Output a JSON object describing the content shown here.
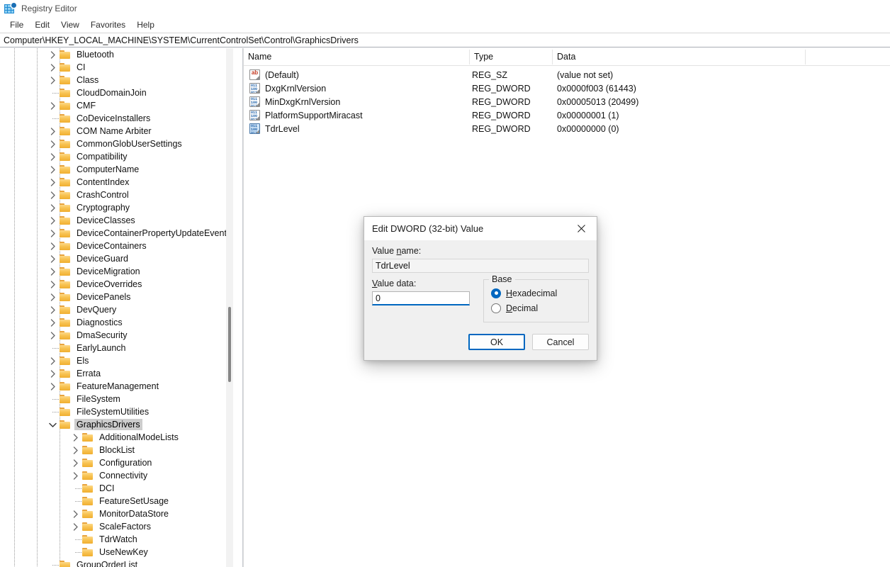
{
  "window": {
    "title": "Registry Editor",
    "icon": "registry-editor-icon"
  },
  "menubar": {
    "items": [
      "File",
      "Edit",
      "View",
      "Favorites",
      "Help"
    ]
  },
  "address": {
    "path": "Computer\\HKEY_LOCAL_MACHINE\\SYSTEM\\CurrentControlSet\\Control\\GraphicsDrivers"
  },
  "tree": {
    "items": [
      {
        "label": "Bluetooth",
        "depth": 1,
        "state": "collapsed",
        "selected": false
      },
      {
        "label": "CI",
        "depth": 1,
        "state": "collapsed",
        "selected": false
      },
      {
        "label": "Class",
        "depth": 1,
        "state": "collapsed",
        "selected": false
      },
      {
        "label": "CloudDomainJoin",
        "depth": 1,
        "state": "leaf",
        "selected": false
      },
      {
        "label": "CMF",
        "depth": 1,
        "state": "collapsed",
        "selected": false
      },
      {
        "label": "CoDeviceInstallers",
        "depth": 1,
        "state": "leaf",
        "selected": false
      },
      {
        "label": "COM Name Arbiter",
        "depth": 1,
        "state": "collapsed",
        "selected": false
      },
      {
        "label": "CommonGlobUserSettings",
        "depth": 1,
        "state": "collapsed",
        "selected": false
      },
      {
        "label": "Compatibility",
        "depth": 1,
        "state": "collapsed",
        "selected": false
      },
      {
        "label": "ComputerName",
        "depth": 1,
        "state": "collapsed",
        "selected": false
      },
      {
        "label": "ContentIndex",
        "depth": 1,
        "state": "collapsed",
        "selected": false
      },
      {
        "label": "CrashControl",
        "depth": 1,
        "state": "collapsed",
        "selected": false
      },
      {
        "label": "Cryptography",
        "depth": 1,
        "state": "collapsed",
        "selected": false
      },
      {
        "label": "DeviceClasses",
        "depth": 1,
        "state": "collapsed",
        "selected": false
      },
      {
        "label": "DeviceContainerPropertyUpdateEvents",
        "depth": 1,
        "state": "collapsed",
        "selected": false
      },
      {
        "label": "DeviceContainers",
        "depth": 1,
        "state": "collapsed",
        "selected": false
      },
      {
        "label": "DeviceGuard",
        "depth": 1,
        "state": "collapsed",
        "selected": false
      },
      {
        "label": "DeviceMigration",
        "depth": 1,
        "state": "collapsed",
        "selected": false
      },
      {
        "label": "DeviceOverrides",
        "depth": 1,
        "state": "collapsed",
        "selected": false
      },
      {
        "label": "DevicePanels",
        "depth": 1,
        "state": "collapsed",
        "selected": false
      },
      {
        "label": "DevQuery",
        "depth": 1,
        "state": "collapsed",
        "selected": false
      },
      {
        "label": "Diagnostics",
        "depth": 1,
        "state": "collapsed",
        "selected": false
      },
      {
        "label": "DmaSecurity",
        "depth": 1,
        "state": "collapsed",
        "selected": false
      },
      {
        "label": "EarlyLaunch",
        "depth": 1,
        "state": "leaf",
        "selected": false
      },
      {
        "label": "Els",
        "depth": 1,
        "state": "collapsed",
        "selected": false
      },
      {
        "label": "Errata",
        "depth": 1,
        "state": "collapsed",
        "selected": false
      },
      {
        "label": "FeatureManagement",
        "depth": 1,
        "state": "collapsed",
        "selected": false
      },
      {
        "label": "FileSystem",
        "depth": 1,
        "state": "leaf",
        "selected": false
      },
      {
        "label": "FileSystemUtilities",
        "depth": 1,
        "state": "leaf",
        "selected": false
      },
      {
        "label": "GraphicsDrivers",
        "depth": 1,
        "state": "expanded",
        "selected": true
      },
      {
        "label": "AdditionalModeLists",
        "depth": 2,
        "state": "collapsed",
        "selected": false
      },
      {
        "label": "BlockList",
        "depth": 2,
        "state": "collapsed",
        "selected": false
      },
      {
        "label": "Configuration",
        "depth": 2,
        "state": "collapsed",
        "selected": false
      },
      {
        "label": "Connectivity",
        "depth": 2,
        "state": "collapsed",
        "selected": false
      },
      {
        "label": "DCI",
        "depth": 2,
        "state": "leaf",
        "selected": false
      },
      {
        "label": "FeatureSetUsage",
        "depth": 2,
        "state": "leaf",
        "selected": false
      },
      {
        "label": "MonitorDataStore",
        "depth": 2,
        "state": "collapsed",
        "selected": false
      },
      {
        "label": "ScaleFactors",
        "depth": 2,
        "state": "collapsed",
        "selected": false
      },
      {
        "label": "TdrWatch",
        "depth": 2,
        "state": "leaf",
        "selected": false
      },
      {
        "label": "UseNewKey",
        "depth": 2,
        "state": "leaf",
        "selected": false
      },
      {
        "label": "GroupOrderList",
        "depth": 1,
        "state": "leaf",
        "selected": false
      }
    ]
  },
  "list": {
    "columns": [
      "Name",
      "Type",
      "Data"
    ],
    "rows": [
      {
        "name": "(Default)",
        "type": "REG_SZ",
        "data": "(value not set)",
        "icon": "string-value-icon",
        "selected": false
      },
      {
        "name": "DxgKrnlVersion",
        "type": "REG_DWORD",
        "data": "0x0000f003 (61443)",
        "icon": "dword-value-icon",
        "selected": false
      },
      {
        "name": "MinDxgKrnlVersion",
        "type": "REG_DWORD",
        "data": "0x00005013 (20499)",
        "icon": "dword-value-icon",
        "selected": false
      },
      {
        "name": "PlatformSupportMiracast",
        "type": "REG_DWORD",
        "data": "0x00000001 (1)",
        "icon": "dword-value-icon",
        "selected": false
      },
      {
        "name": "TdrLevel",
        "type": "REG_DWORD",
        "data": "0x00000000 (0)",
        "icon": "dword-value-icon",
        "selected": true
      }
    ]
  },
  "dialog": {
    "title": "Edit DWORD (32-bit) Value",
    "close_icon": "close-icon",
    "value_name_label": "Value name:",
    "value_name": "TdrLevel",
    "value_data_label": "Value data:",
    "value_data": "0",
    "base_legend": "Base",
    "base_options": [
      "Hexadecimal",
      "Decimal"
    ],
    "base_selected": "Hexadecimal",
    "ok_label": "OK",
    "cancel_label": "Cancel"
  },
  "colors": {
    "accent": "#0067c0",
    "selection": "#cdcdcd",
    "folder": "#f5bf45"
  }
}
